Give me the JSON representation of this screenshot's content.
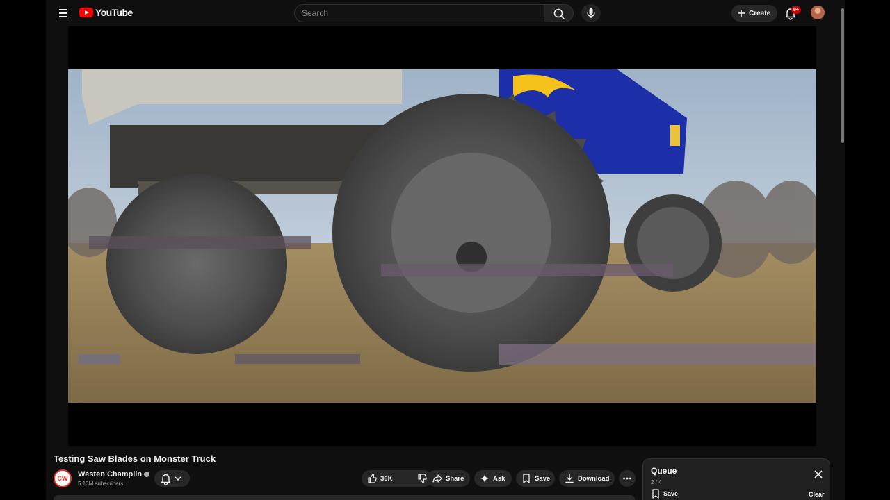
{
  "header": {
    "logo_text": "YouTube",
    "search_placeholder": "Search",
    "create_label": "Create",
    "notification_count": "9+"
  },
  "video": {
    "title": "Testing Saw Blades on Monster Truck"
  },
  "channel": {
    "name": "Westen Champlin",
    "subscribers": "5.13M subscribers",
    "avatar_initials": "CW"
  },
  "actions": {
    "like_count": "36K",
    "share_label": "Share",
    "ask_label": "Ask",
    "save_label": "Save",
    "download_label": "Download"
  },
  "queue": {
    "title": "Queue",
    "position": "2 / 4",
    "save_label": "Save",
    "clear_label": "Clear"
  },
  "icons": [
    "menu-icon",
    "youtube-logo-icon",
    "search-icon",
    "mic-icon",
    "plus-icon",
    "bell-icon",
    "verified-icon",
    "chevron-down-icon",
    "like-icon",
    "dislike-icon",
    "share-icon",
    "sparkle-icon",
    "bookmark-icon",
    "download-icon",
    "more-icon",
    "close-icon"
  ],
  "colors": {
    "background": "#0f0f0f",
    "brand_red": "#ff0000",
    "pill": "#272727",
    "badge": "#cc0000"
  }
}
